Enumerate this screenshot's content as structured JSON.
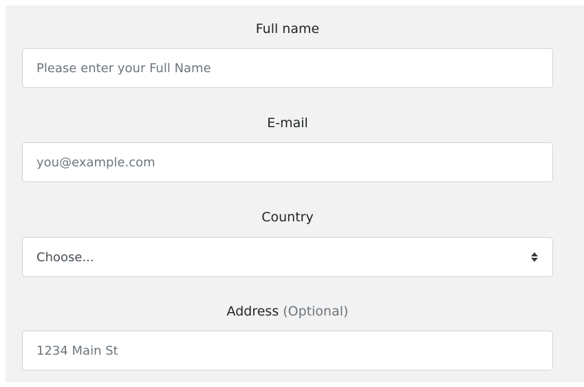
{
  "form": {
    "full_name": {
      "label": "Full name",
      "placeholder": "Please enter your Full Name"
    },
    "email": {
      "label": "E-mail",
      "placeholder": "you@example.com"
    },
    "country": {
      "label": "Country",
      "selected": "Choose..."
    },
    "address": {
      "label": "Address",
      "label_note": "(Optional)",
      "placeholder": "1234 Main St"
    }
  },
  "icons": {
    "country_select": "sort-icon"
  },
  "colors": {
    "panel_background": "#f2f2f2",
    "input_border": "#ced4da",
    "placeholder_text": "#6c757d",
    "label_text": "#212529"
  }
}
